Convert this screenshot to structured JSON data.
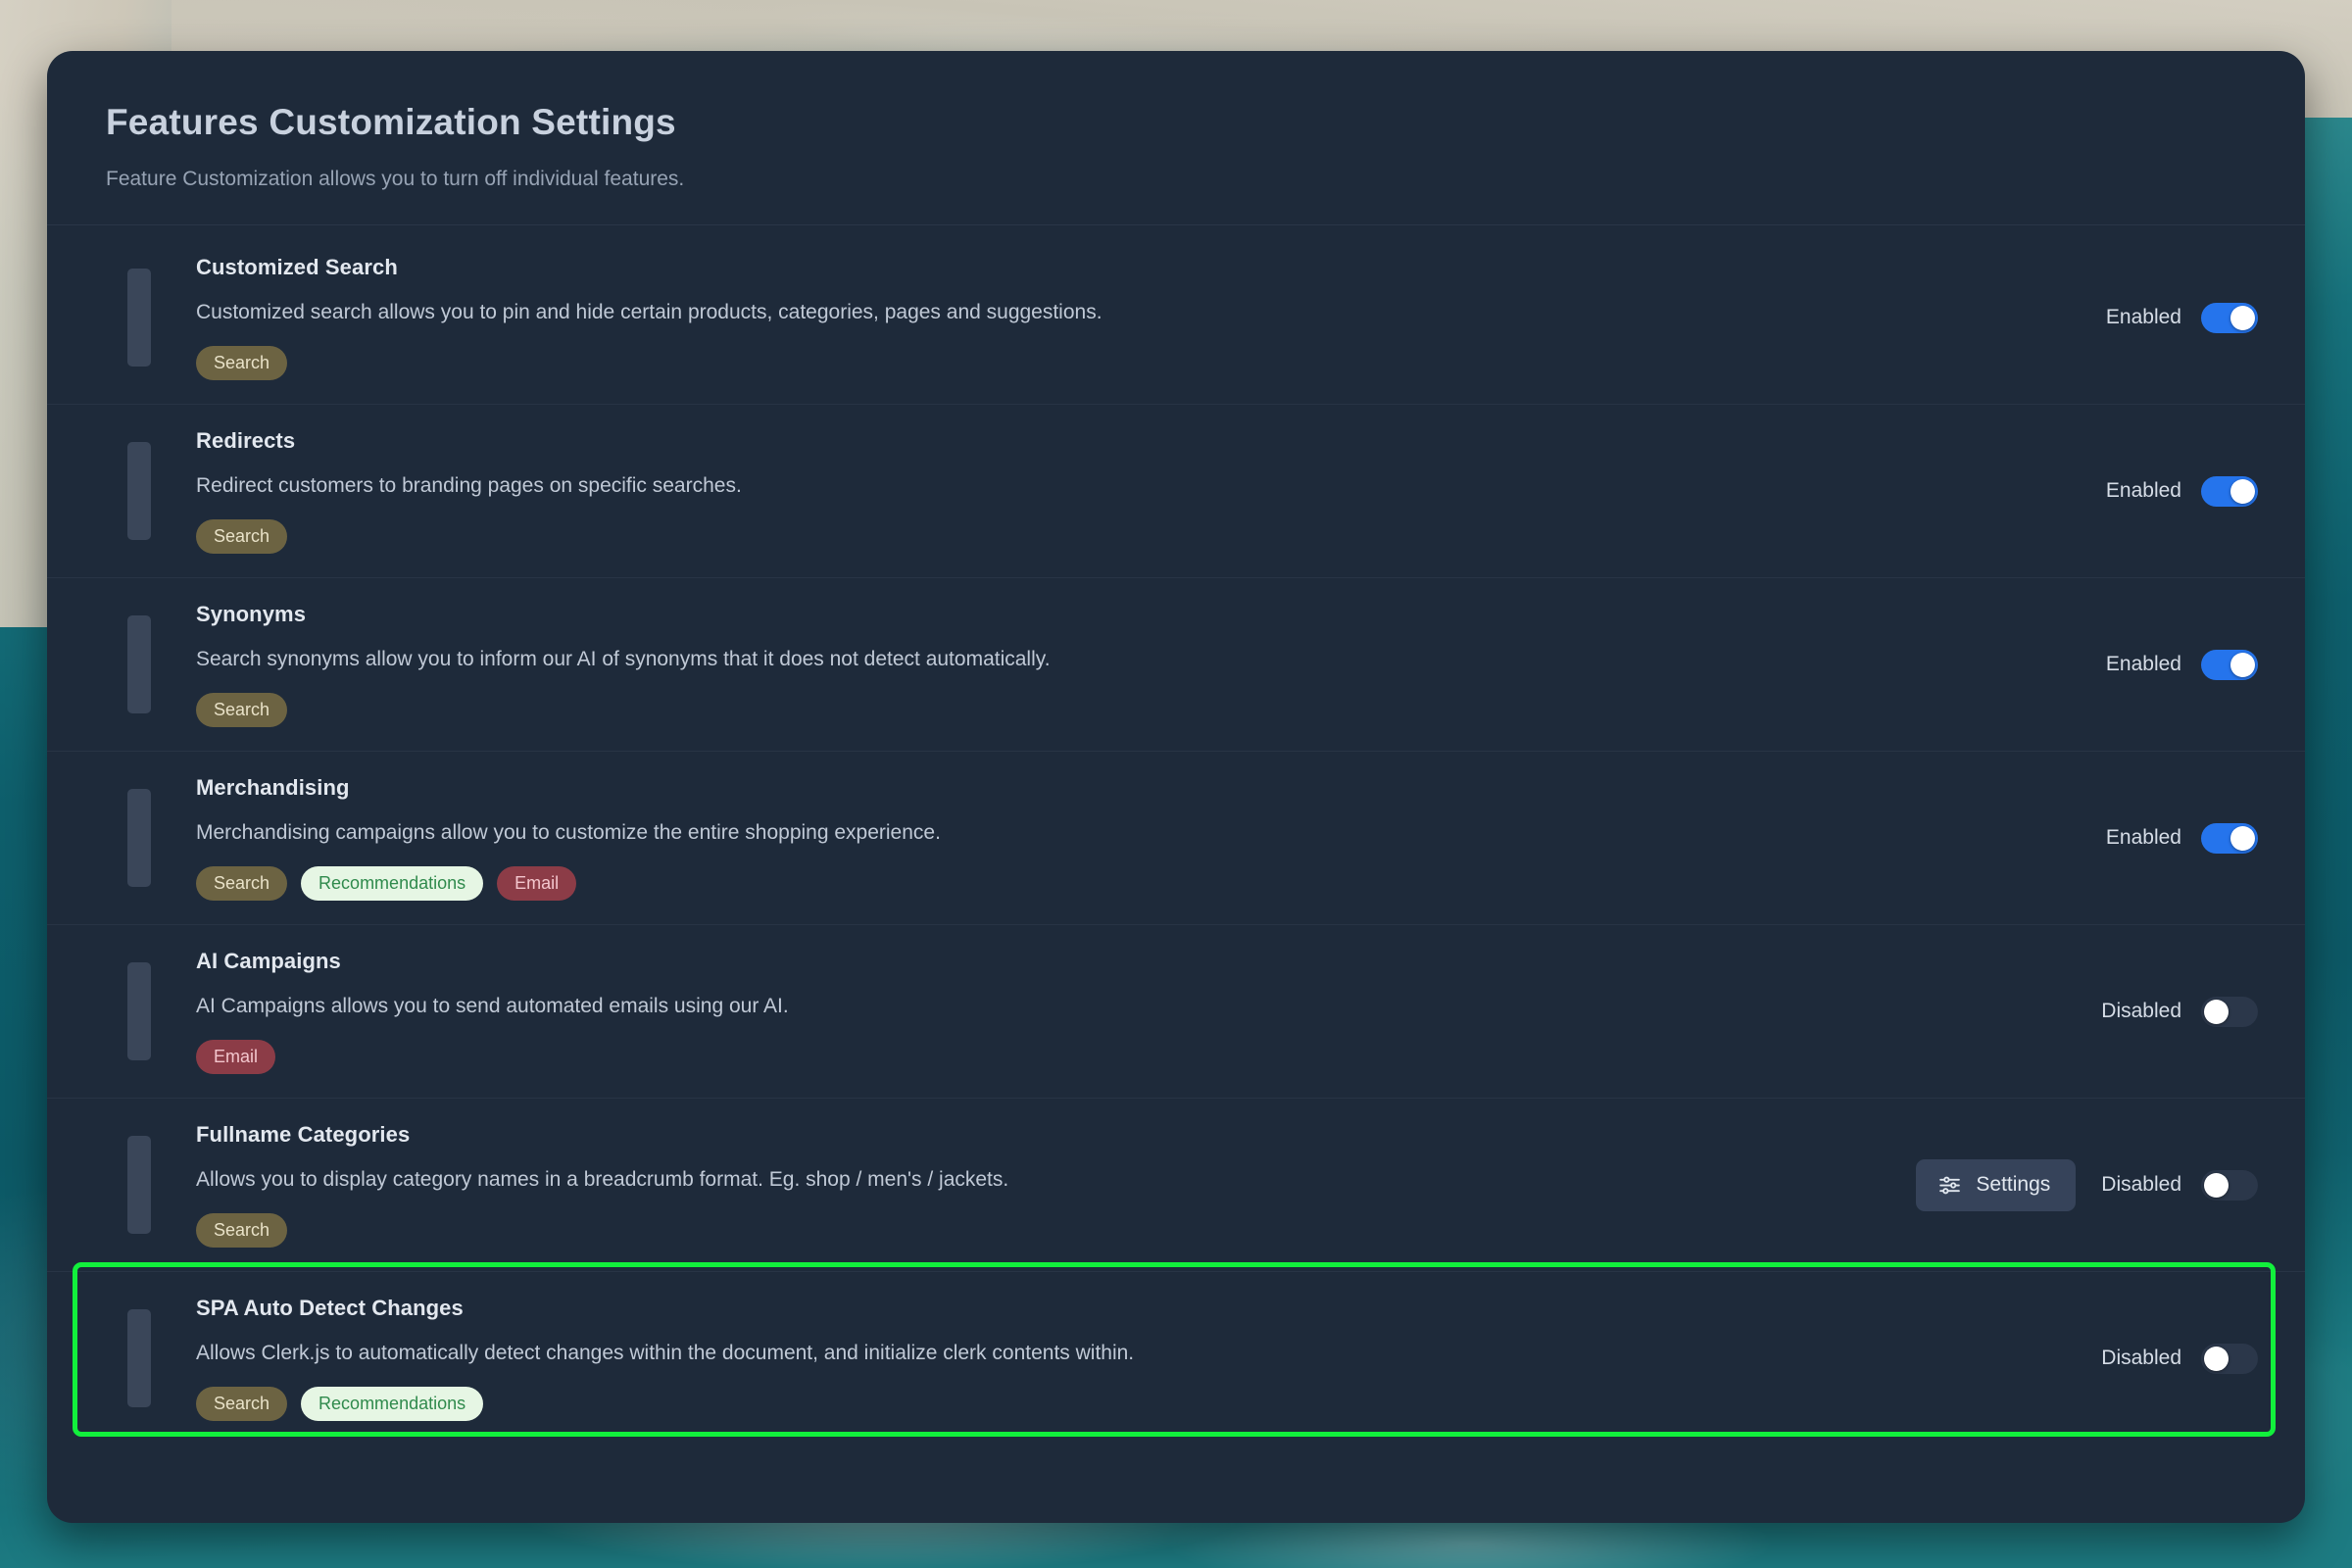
{
  "page": {
    "title": "Features Customization Settings",
    "subtitle": "Feature Customization allows you to turn off individual features."
  },
  "labels": {
    "enabled": "Enabled",
    "disabled": "Disabled",
    "settings_button": "Settings"
  },
  "colors": {
    "toggle_on": "#2574ec",
    "toggle_off_track": "#2b374a",
    "toggle_knob": "#ffffff",
    "panel_background": "#1e2a3a",
    "accent_bar": "#3a4659",
    "highlight_border": "#12f03c",
    "badge_search_bg": "#6c6342",
    "badge_search_text": "#e9e2c8",
    "badge_recommendations_bg": "#e6f6e4",
    "badge_recommendations_text": "#2f8a4c",
    "badge_email_bg": "#8c3c47",
    "badge_email_text": "#f3c6cd"
  },
  "features": [
    {
      "name": "Customized Search",
      "description": "Customized search allows you to pin and hide certain products, categories, pages and suggestions.",
      "badges": [
        "Search"
      ],
      "status": "Enabled",
      "toggle_on": true,
      "has_settings_button": false,
      "highlighted": false
    },
    {
      "name": "Redirects",
      "description": "Redirect customers to branding pages on specific searches.",
      "badges": [
        "Search"
      ],
      "status": "Enabled",
      "toggle_on": true,
      "has_settings_button": false,
      "highlighted": false
    },
    {
      "name": "Synonyms",
      "description": "Search synonyms allow you to inform our AI of synonyms that it does not detect automatically.",
      "badges": [
        "Search"
      ],
      "status": "Enabled",
      "toggle_on": true,
      "has_settings_button": false,
      "highlighted": false
    },
    {
      "name": "Merchandising",
      "description": "Merchandising campaigns allow you to customize the entire shopping experience.",
      "badges": [
        "Search",
        "Recommendations",
        "Email"
      ],
      "status": "Enabled",
      "toggle_on": true,
      "has_settings_button": false,
      "highlighted": false
    },
    {
      "name": "AI Campaigns",
      "description": "AI Campaigns allows you to send automated emails using our AI.",
      "badges": [
        "Email"
      ],
      "status": "Disabled",
      "toggle_on": false,
      "has_settings_button": false,
      "highlighted": false
    },
    {
      "name": "Fullname Categories",
      "description": "Allows you to display category names in a breadcrumb format. Eg. shop / men's / jackets.",
      "badges": [
        "Search"
      ],
      "status": "Disabled",
      "toggle_on": false,
      "has_settings_button": true,
      "highlighted": false
    },
    {
      "name": "SPA Auto Detect Changes",
      "description": "Allows Clerk.js to automatically detect changes within the document, and initialize clerk contents within.",
      "badges": [
        "Search",
        "Recommendations"
      ],
      "status": "Disabled",
      "toggle_on": false,
      "has_settings_button": false,
      "highlighted": true
    }
  ]
}
